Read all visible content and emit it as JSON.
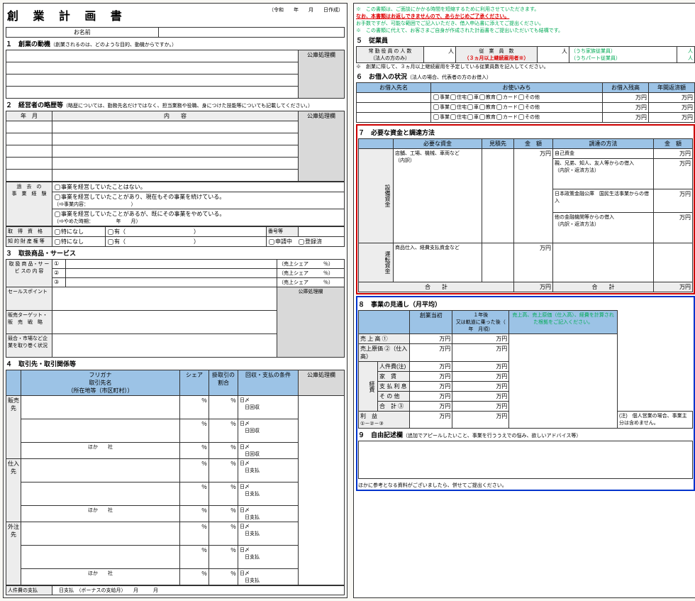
{
  "hdr": {
    "title": "創 業 計 画 書",
    "era": "令和",
    "y": "年",
    "m": "月",
    "d": "日作成",
    "name": "お名前",
    "dash": "公庫処理欄"
  },
  "s1": {
    "t": "１　創業の動機",
    "sub": "（創業されるのは、どのような目的、動機からですか。）"
  },
  "s2": {
    "t": "２　経営者の略歴等",
    "sub": "（略歴については、勤務先名だけではなく、担当業務や役職、身につけた技能等についても記載してください。）",
    "ym": "年　月",
    "cont": "内　　容"
  },
  "s2b": {
    "past": "過　去　の",
    "biz": "事　業　経　験",
    "c1": "事業を経営していたことはない。",
    "c2": "事業を経営していたことがあり、現在もその事業を続けている。",
    "c2s": "（⇒事業内容：　　　　　　　　　）",
    "c3": "事業を経営していたことがあるが、既にその事業をやめている。",
    "c3s": "（⇒やめた時期：　　　　　年　　月）",
    "qual": "取　得　資　格",
    "none": "特になし",
    "yes": "有",
    "no": "番号等",
    "ip": "知 的 財 産 権 等",
    "app": "申請中",
    "reg": "登録済"
  },
  "s3": {
    "t": "３　取扱商品・サービス",
    "prod": "取 扱 商 品・サ ー ビ スの 内 容",
    "n1": "①",
    "n2": "②",
    "n3": "③",
    "share": "（売上シェア　　　％）",
    "sp": "セールスポイント",
    "tgt": "販売ターゲット・販　売　戦　略",
    "comp": "競合・市場など企業を取り巻く状況"
  },
  "s4": {
    "t": "４　取引先・取引関係等",
    "furi": "フリガナ",
    "addr": "取引先名",
    "loc": "（所在地等（市区町村））",
    "sh": "シェア",
    "cr": "掛取引の割合",
    "pay": "回収・支払の条件",
    "sales": "販売先",
    "supp": "仕入先",
    "ext": "外注先",
    "d": "日〆",
    "dr": "日回収",
    "dp": "日支払",
    "pct": "％",
    "etc": "ほか　　社",
    "lab": "人件費の支払",
    "bon": "（ボーナスの支給月）"
  },
  "rtop": {
    "w1": "※　この書類は、ご面談にかかる時間を短縮するために利用させていただきます。",
    "w2": "なお、本書類はお返しできませんので、あらかじめご了承ください。",
    "w3": "お手数ですが、可能な範囲でご記入いただき、借入申込書に添えてご提出ください。",
    "w4": "※　この書類に代えて、お客さまご自身が作成された計画書をご提出いただいても結構です。"
  },
  "s5": {
    "t": "５　従業員",
    "emp": "常 勤 役 員 の 人 数",
    "corp": "（法人の方のみ）",
    "p": "人",
    "work": "従　業　員　数",
    "m3": "（３ヵ月以上継続雇用者※）",
    "f1": "（うち家族従業員）",
    "f2": "（うちパート従業員）",
    "note": "※　創業に際して、３ヵ月以上継続雇用を予定している従業員数を記入してください。"
  },
  "s6": {
    "t": "６　お借入の状況",
    "sub": "（法人の場合、代表者の方のお借入）",
    "from": "お借入先名",
    "use": "お使いみち",
    "bal": "お借入残高",
    "ann": "年間返済額",
    "c": {
      "biz": "事業",
      "home": "住宅",
      "car": "車",
      "edu": "教育",
      "card": "カード",
      "oth": "その他"
    },
    "yen": "万円"
  },
  "s7": {
    "t": "７　必要な資金と調達方法",
    "need": "必要な資金",
    "est": "見積先",
    "amt": "金　額",
    "fin": "調達の方法",
    "setsu": "設備資金",
    "unten": "運転資金",
    "t1": "店舗、工場、機械、車両など",
    "t2": "（内訳）",
    "t3": "商品仕入、経費支払資金など",
    "f1": "自己資金",
    "f2": "親、兄弟、知人、友人等からの借入",
    "f2s": "（内訳・返済方法）",
    "f3": "日本政策金融公庫　国民生活事業からの借入",
    "f4": "他の金融機関等からの借入",
    "tot": "合　　計"
  },
  "s8": {
    "t": "８　事業の見通し（月平均）",
    "init": "創業当初",
    "y1": "１年後",
    "y1s": "又は軌道に乗った後（　年　月頃）",
    "note": "売上高、売上原価（仕入高）、経費を計算された根拠をご記入ください。",
    "sl": "売 上 高 ①",
    "cg": "売上原価 ②（仕入高）",
    "exp": "経費",
    "pers": "人件費(注)",
    "rent": "家　賃",
    "int": "支 払 利 息",
    "oth": "そ の 他",
    "st": "合　計 ③",
    "prof": "利　益",
    "calc": "①－②－③",
    "cn": "(注)　個人営業の場合、事業主分は含めません。"
  },
  "s9": {
    "t": "９　自由記述欄",
    "sub": "（追加でアピールしたいこと、事業を行ううえでの悩み、欲しいアドバイス等）",
    "foot": "ほかに参考となる資料がございましたら、併せてご提出ください。"
  }
}
